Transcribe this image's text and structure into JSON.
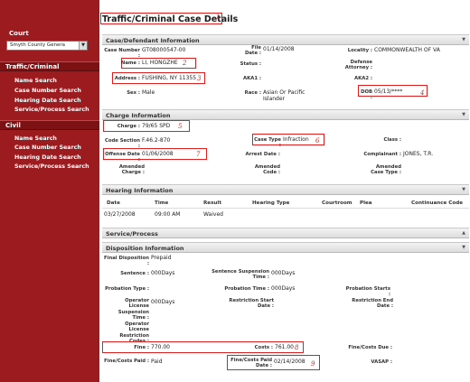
{
  "sidebar": {
    "court_label": "Court",
    "court_select": "Smyth County Genera",
    "traffic_header": "Traffic/Criminal",
    "traffic_links": [
      "Name Search",
      "Case Number Search",
      "Hearing Date Search",
      "Service/Process Search"
    ],
    "civil_header": "Civil",
    "civil_links": [
      "Name Search",
      "Case Number Search",
      "Hearing Date Search",
      "Service/Process Search"
    ]
  },
  "page": {
    "title": "Traffic/Criminal Case Details"
  },
  "case": {
    "section": "Case/Defendant Information",
    "case_number_label": "Case Number :",
    "case_number": "GT08000547-00",
    "file_date_label": "File Date :",
    "file_date": "01/14/2008",
    "locality_label": "Locality :",
    "locality": "COMMONWEALTH OF VA",
    "name_label": "Name :",
    "name": "LI, HONGZHE",
    "status_label": "Status :",
    "defense_label": "Defense Attorney :",
    "address_label": "Address :",
    "address": "FUSHING, NY 11355",
    "aka1_label": "AKA1 :",
    "aka2_label": "AKA2 :",
    "sex_label": "Sex :",
    "sex": "Male",
    "race_label": "Race :",
    "race": "Asian Or Pacific Islander",
    "dob_label": "DOB :",
    "dob": "05/13/****"
  },
  "charge": {
    "section": "Charge Information",
    "charge_label": "Charge :",
    "charge": "79/65 SPD",
    "code_label": "Code Section :",
    "code": "F.46.2-870",
    "case_type_label": "Case Type :",
    "case_type": "Infraction",
    "class_label": "Class :",
    "offense_label": "Offense Date :",
    "offense": "01/06/2008",
    "arrest_label": "Arrest Date :",
    "complainant_label": "Complainant :",
    "complainant": "JONES, T.R.",
    "amended_charge_label": "Amended Charge :",
    "amended_code_label": "Amended Code :",
    "amended_type_label": "Amended Case Type :"
  },
  "hearing": {
    "section": "Hearing Information",
    "columns": [
      "Date",
      "Time",
      "Result",
      "Hearing Type",
      "Courtroom",
      "Plea",
      "Continuance Code"
    ],
    "row": [
      "03/27/2008",
      "09:00 AM",
      "Waived",
      "",
      "",
      "",
      ""
    ]
  },
  "service": {
    "section": "Service/Process"
  },
  "disposition": {
    "section": "Disposition Information",
    "final_label": "Final Disposition :",
    "final": "Prepaid",
    "sentence_label": "Sentence :",
    "sentence": "000Days",
    "susp_label": "Sentence Suspension Time :",
    "susp": "000Days",
    "probation_type_label": "Probation Type :",
    "probation_time_label": "Probation Time :",
    "probation_time": "000Days",
    "probation_starts_label": "Probation Starts :",
    "op_susp_label": "Operator License Suspension Time :",
    "op_susp": "000Days",
    "restr_start_label": "Restriction Start Date :",
    "restr_end_label": "Restriction End Date :",
    "op_restr_label": "Operator License Restriction Codes :",
    "fine_label": "Fine :",
    "fine": "770.00",
    "costs_label": "Costs :",
    "costs": "761.00",
    "fine_due_label": "Fine/Costs Due :",
    "fine_paid_label": "Fine/Costs Paid :",
    "fine_paid": "Paid",
    "fine_paid_date_label": "Fine/Costs Paid Date :",
    "fine_paid_date": "02/14/2008",
    "vasap_label": "VASAP :"
  },
  "annotations": [
    "1",
    "2",
    "3",
    "4",
    "5",
    "6",
    "7",
    "8",
    "9"
  ]
}
